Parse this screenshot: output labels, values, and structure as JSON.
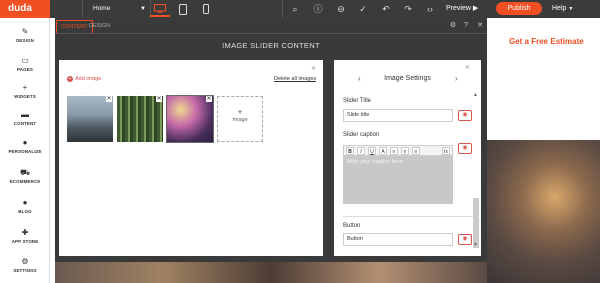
{
  "topbar": {
    "logo": "duda",
    "page_select": "Home",
    "icons": [
      "search-icon",
      "info-icon",
      "zoom-out-icon",
      "check-icon",
      "undo-icon",
      "redo-icon",
      "code-icon"
    ],
    "preview_label": "Preview",
    "publish_label": "Publish",
    "help_label": "Help"
  },
  "sidebar": {
    "items": [
      {
        "label": "DESIGN",
        "icon": "palette-icon"
      },
      {
        "label": "PAGES",
        "icon": "pages-icon"
      },
      {
        "label": "WIDGETS",
        "icon": "plus-icon"
      },
      {
        "label": "CONTENT",
        "icon": "folder-icon"
      },
      {
        "label": "PERSONALIZE",
        "icon": "person-icon"
      },
      {
        "label": "ECOMMERCE",
        "icon": "cart-icon"
      },
      {
        "label": "BLOG",
        "icon": "chat-icon"
      },
      {
        "label": "APP STORE",
        "icon": "puzzle-icon"
      },
      {
        "label": "SETTINGS",
        "icon": "gear-icon"
      }
    ]
  },
  "site": {
    "cta_text": "Get a Free Estimate"
  },
  "editor": {
    "tabs": [
      {
        "label": "CONTENT"
      },
      {
        "label": "DESIGN"
      }
    ],
    "title": "IMAGE SLIDER CONTENT",
    "add_image_label": "Add image",
    "delete_all_label": "Delete all images",
    "add_tile_label": "Image",
    "settings": {
      "title": "Image Settings",
      "slider_title_label": "Slider Title",
      "slider_title_value": "Slide title",
      "caption_label": "Slider caption",
      "caption_placeholder": "Write your caption here",
      "button_label": "Button",
      "button_value": "Button",
      "rte_buttons": [
        "B",
        "I",
        "U",
        "A",
        "≡",
        "≡",
        "≡",
        "Ix"
      ]
    }
  },
  "colors": {
    "accent": "#f04e23",
    "dark": "#3a3a3a"
  }
}
